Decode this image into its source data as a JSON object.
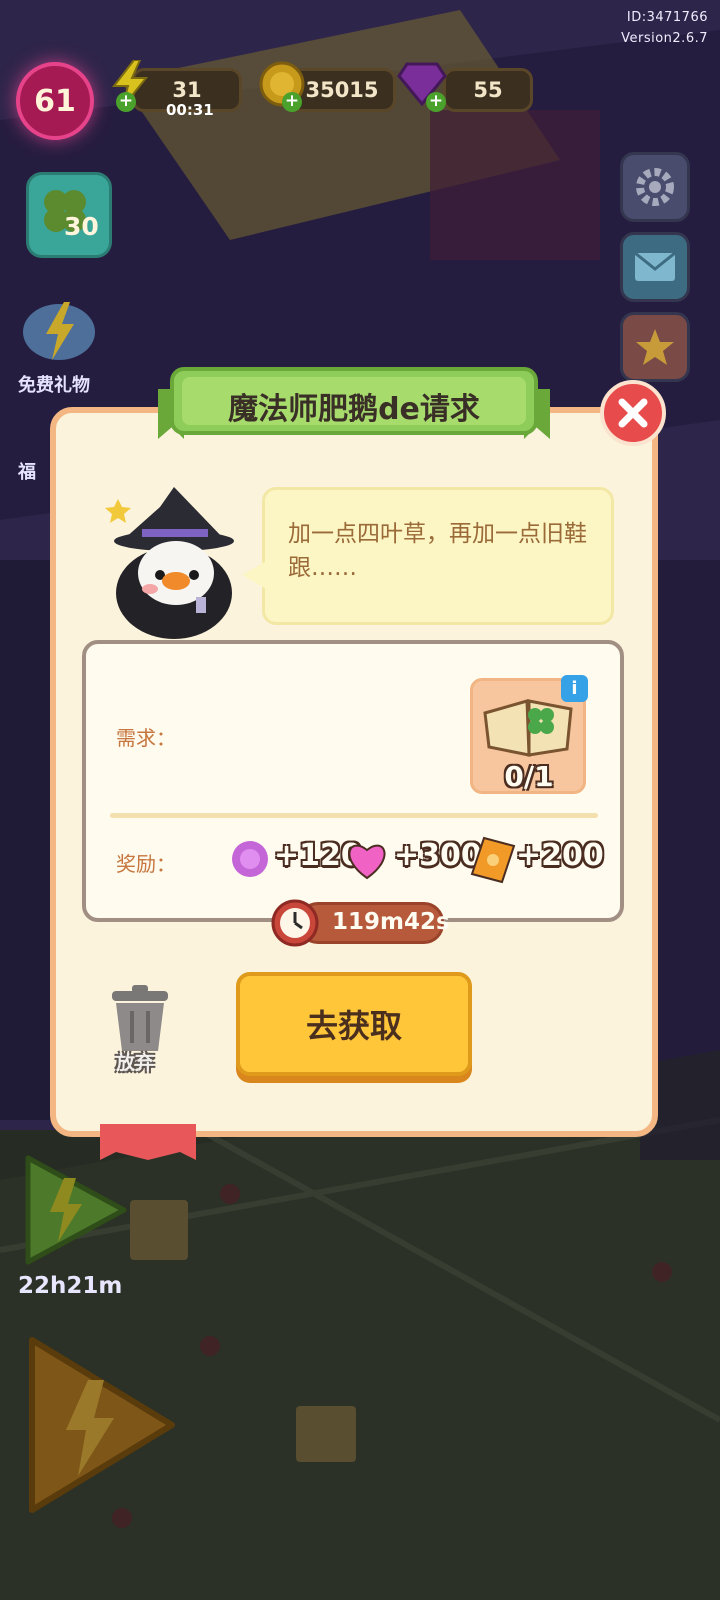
{
  "meta": {
    "id": "ID:3471766",
    "version": "Version2.6.7"
  },
  "hud": {
    "level": "61",
    "energy": "31",
    "energy_timer": "00:31",
    "coins": "35015",
    "gems": "55"
  },
  "left_panel": {
    "clover_count": "30",
    "free_gift_label": "免费礼物",
    "partial_label": "福",
    "boost_timer": "22h21m"
  },
  "dialog": {
    "title": "魔法师肥鹅de请求",
    "speech": "加一点四叶草，再加一点旧鞋跟……",
    "requirement_label": "需求：",
    "item_progress": "0/1",
    "reward_label": "奖励：",
    "rewards": [
      {
        "icon": "purple-flower-icon",
        "value": "+120"
      },
      {
        "icon": "pink-heart-icon",
        "value": "+300"
      },
      {
        "icon": "orange-ticket-icon",
        "value": "+200"
      }
    ],
    "timer": "119m42s",
    "discard_label": "放弃",
    "go_button": "去获取"
  },
  "colors": {
    "panel": "#fbf3dc",
    "panel_border": "#f4b783",
    "banner_green": "#8fcd5a",
    "button_yellow": "#ffc63a",
    "close_red": "#e84b4b"
  }
}
